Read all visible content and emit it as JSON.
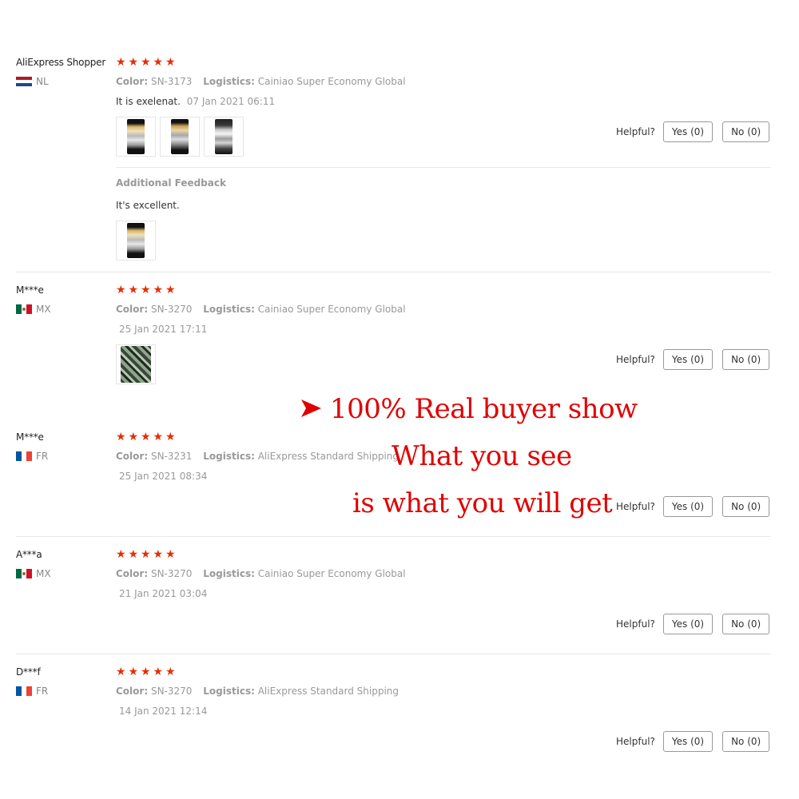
{
  "reviews": [
    {
      "name": "AliExpress Shopper",
      "country": "NL",
      "stars": 5,
      "color_label": "Color:",
      "color_value": "SN-3173",
      "logistics_label": "Logistics:",
      "logistics_value": "Cainiao Super Economy Global",
      "text": "It is exelenat.",
      "date": "07 Jan 2021 06:11",
      "helpful_label": "Helpful?",
      "yes_label": "Yes (0)",
      "no_label": "No (0)",
      "additional_title": "Additional Feedback",
      "additional_text": "It's excellent."
    },
    {
      "name": "M***e",
      "country": "MX",
      "stars": 5,
      "color_label": "Color:",
      "color_value": "SN-3270",
      "logistics_label": "Logistics:",
      "logistics_value": "Cainiao Super Economy Global",
      "date": "25 Jan 2021 17:11",
      "helpful_label": "Helpful?",
      "yes_label": "Yes (0)",
      "no_label": "No (0)"
    },
    {
      "name": "M***e",
      "country": "FR",
      "stars": 5,
      "color_label": "Color:",
      "color_value": "SN-3231",
      "logistics_label": "Logistics:",
      "logistics_value": "AliExpress Standard Shipping",
      "date": "25 Jan 2021 08:34",
      "helpful_label": "Helpful?",
      "yes_label": "Yes (0)",
      "no_label": "No (0)"
    },
    {
      "name": "A***a",
      "country": "MX",
      "stars": 5,
      "color_label": "Color:",
      "color_value": "SN-3270",
      "logistics_label": "Logistics:",
      "logistics_value": "Cainiao Super Economy Global",
      "date": "21 Jan 2021 03:04",
      "helpful_label": "Helpful?",
      "yes_label": "Yes (0)",
      "no_label": "No (0)"
    },
    {
      "name": "D***f",
      "country": "FR",
      "stars": 5,
      "color_label": "Color:",
      "color_value": "SN-3270",
      "logistics_label": "Logistics:",
      "logistics_value": "AliExpress Standard Shipping",
      "date": "14 Jan 2021 12:14",
      "helpful_label": "Helpful?",
      "yes_label": "Yes (0)",
      "no_label": "No (0)"
    }
  ],
  "overlay": {
    "line1": "100% Real buyer show",
    "line2": "What you see",
    "line3": "is what you will get"
  },
  "colors": {
    "star": "#e62e04",
    "overlay_text": "#e00000"
  },
  "icons": {
    "star": "star-icon",
    "arrow": "arrowhead-icon",
    "flag_nl": "flag-nl-icon",
    "flag_mx": "flag-mx-icon",
    "flag_fr": "flag-fr-icon"
  }
}
